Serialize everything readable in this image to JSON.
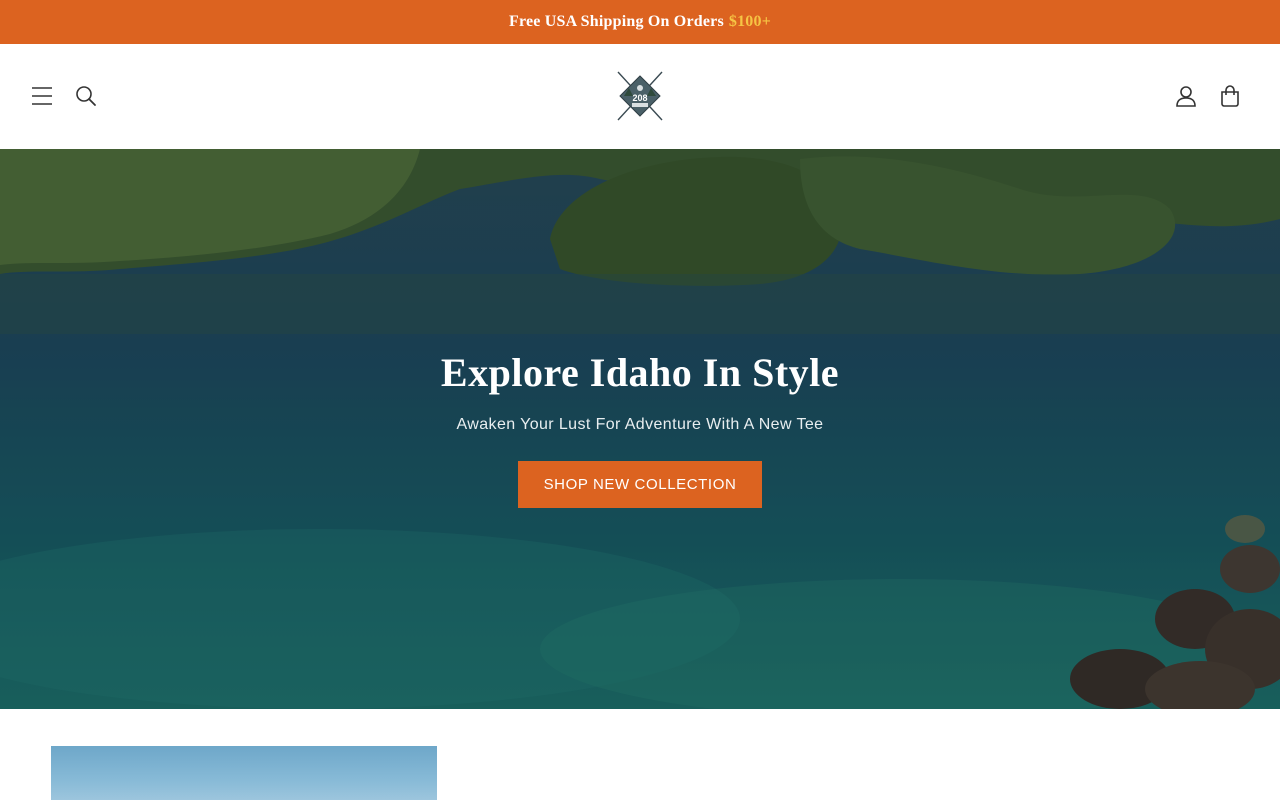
{
  "announcement": {
    "text": "Free USA Shipping On Orders",
    "price": "$100+"
  },
  "header": {
    "logo_text": "208",
    "icons": [
      "menu-icon",
      "search-icon",
      "account-icon",
      "cart-icon"
    ]
  },
  "hero": {
    "title": "Explore Idaho In Style",
    "subtitle": "Awaken Your Lust For Adventure With A New Tee",
    "button_label": "SHOP NEW COLLECTION"
  },
  "colors": {
    "accent": "#dc6320",
    "price_highlight": "#f6c444"
  }
}
